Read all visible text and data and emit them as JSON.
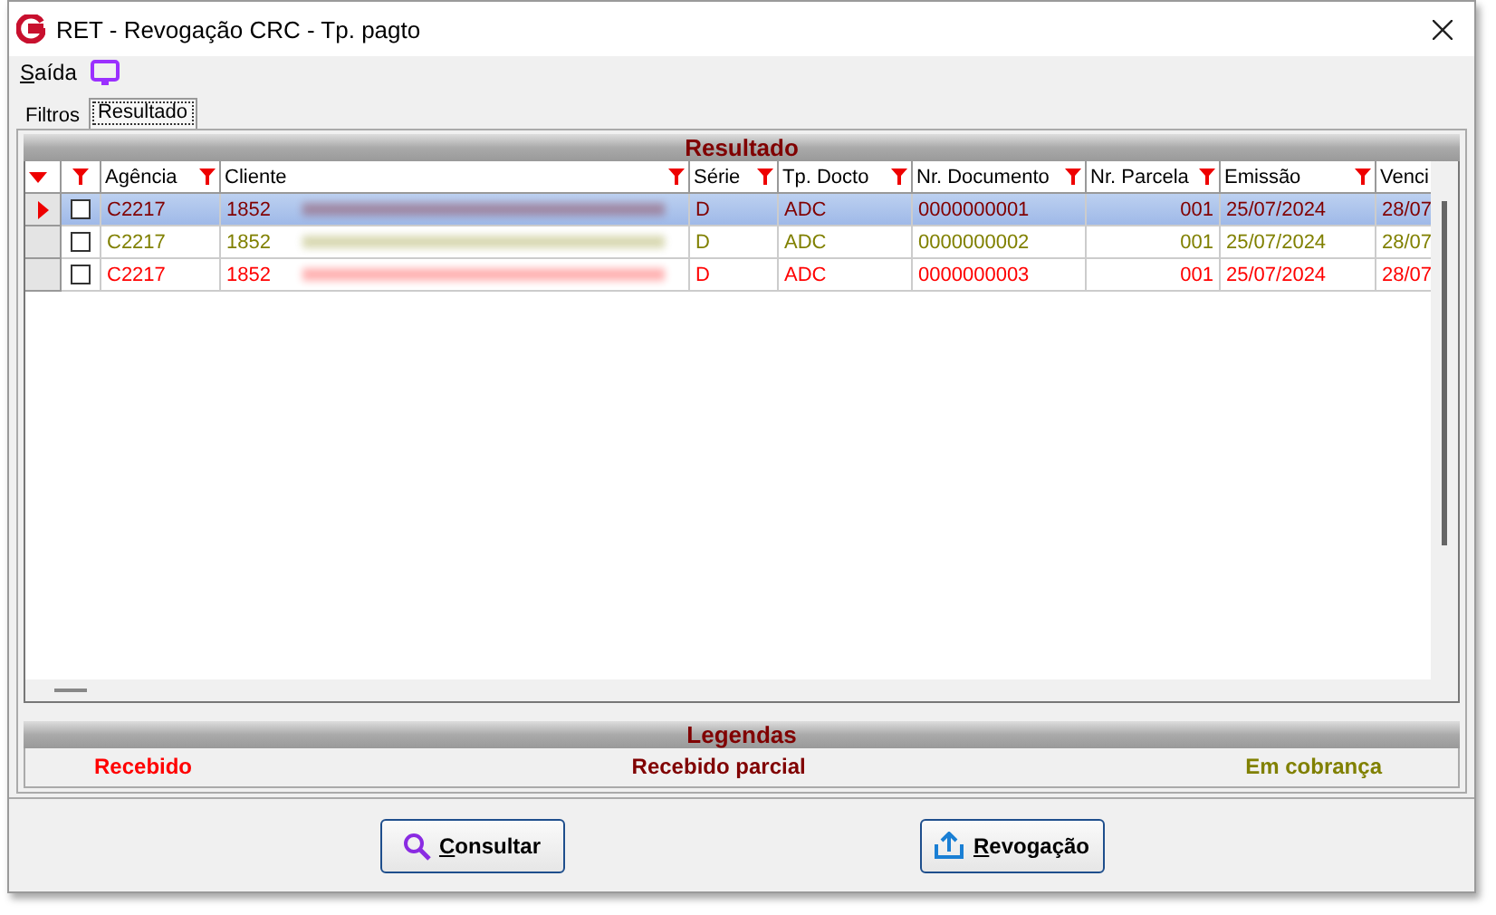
{
  "window": {
    "title": "RET - Revogação CRC - Tp. pagto"
  },
  "menu": [
    {
      "label": "Saída"
    }
  ],
  "tabs": [
    {
      "label": "Filtros",
      "selected": false
    },
    {
      "label": "Resultado",
      "selected": true
    }
  ],
  "grid": {
    "title": "Resultado",
    "columns": [
      {
        "label": "Agência",
        "kind": "text"
      },
      {
        "label": "Cliente",
        "kind": "client"
      },
      {
        "label": "Série",
        "kind": "text"
      },
      {
        "label": "Tp. Docto",
        "kind": "text"
      },
      {
        "label": "Nr. Documento",
        "kind": "text"
      },
      {
        "label": "Nr. Parcela",
        "kind": "number"
      },
      {
        "label": "Emissão",
        "kind": "text"
      },
      {
        "label": "Venci",
        "kind": "cut"
      }
    ],
    "rows": [
      {
        "selected": true,
        "checked": false,
        "color": "#800000",
        "cells": [
          "C2217",
          "1852",
          "D",
          "ADC",
          "0000000001",
          "001",
          "25/07/2024",
          "28/07"
        ]
      },
      {
        "selected": false,
        "checked": false,
        "color": "#808000",
        "cells": [
          "C2217",
          "1852",
          "D",
          "ADC",
          "0000000002",
          "001",
          "25/07/2024",
          "28/07"
        ]
      },
      {
        "selected": false,
        "checked": false,
        "color": "#ff0000",
        "cells": [
          "C2217",
          "1852",
          "D",
          "ADC",
          "0000000003",
          "001",
          "25/07/2024",
          "28/07"
        ]
      }
    ]
  },
  "legend": {
    "title": "Legendas",
    "items": [
      {
        "label": "Recebido",
        "color": "#ff0000"
      },
      {
        "label": "Recebido parcial",
        "color": "#800000"
      },
      {
        "label": "Em cobrança",
        "color": "#808000"
      }
    ]
  },
  "buttons": [
    {
      "label": "Consultar",
      "kind": "search"
    },
    {
      "label": "Revogação",
      "kind": "upload"
    }
  ]
}
